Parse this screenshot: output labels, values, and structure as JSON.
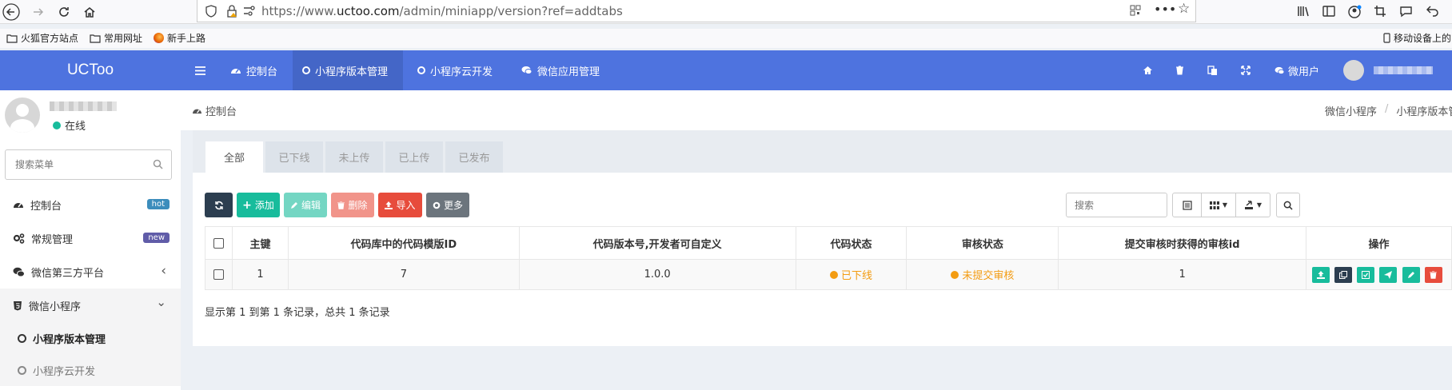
{
  "browser": {
    "url_prefix": "https://www.",
    "url_domain": "uctoo.com",
    "url_rest": "/admin/miniapp/version?ref=addtabs",
    "bookmarks": [
      "火狐官方站点",
      "常用网址",
      "新手上路"
    ],
    "mobile_bookmarks": "移动设备上的"
  },
  "header": {
    "logo": "UCToo",
    "tabs": [
      {
        "label": "控制台",
        "icon": "dashboard-icon"
      },
      {
        "label": "小程序版本管理",
        "icon": "circle-icon"
      },
      {
        "label": "小程序云开发",
        "icon": "circle-icon"
      },
      {
        "label": "微信应用管理",
        "icon": "chat-icon"
      }
    ],
    "user_label": "微用户"
  },
  "sidebar": {
    "status": "在线",
    "search_placeholder": "搜索菜单",
    "items": [
      {
        "label": "控制台",
        "badge": "hot",
        "badge_color": "#3c8dbc"
      },
      {
        "label": "常规管理",
        "badge": "new",
        "badge_color": "#605ca8"
      },
      {
        "label": "微信第三方平台",
        "arrow": "‹"
      },
      {
        "label": "微信小程序",
        "arrow": "⌄"
      }
    ],
    "subitems": [
      {
        "label": "小程序版本管理"
      },
      {
        "label": "小程序云开发"
      }
    ]
  },
  "breadcrumb": {
    "home": "控制台",
    "right": [
      "微信小程序",
      "/",
      "小程序版本管"
    ]
  },
  "panel": {
    "tabs": [
      "全部",
      "已下线",
      "未上传",
      "已上传",
      "已发布"
    ],
    "buttons": {
      "add": "添加",
      "edit": "编辑",
      "delete": "删除",
      "import": "导入",
      "more": "更多"
    },
    "search_placeholder": "搜索",
    "columns": [
      "主键",
      "代码库中的代码模版ID",
      "代码版本号,开发者可自定义",
      "代码状态",
      "审核状态",
      "提交审核时获得的审核id",
      "操作"
    ],
    "rows": [
      {
        "id": "1",
        "template_id": "7",
        "version": "1.0.0",
        "code_status": "已下线",
        "audit_status": "未提交审核",
        "audit_id": "1"
      }
    ],
    "footer": "显示第 1 到第 1 条记录，总共 1 条记录"
  },
  "colors": {
    "header": "#4e73df",
    "primary": "#18bc9c",
    "dark": "#2c3e50",
    "danger": "#e74c3c",
    "warning": "#f39c12"
  }
}
